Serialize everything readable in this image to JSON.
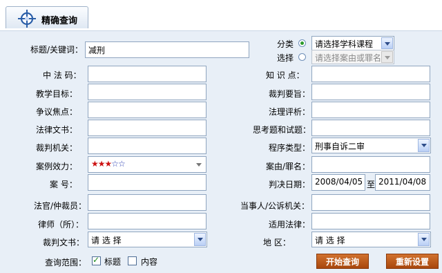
{
  "tab": {
    "label": "精确查询"
  },
  "form": {
    "keyword_label": "标题/关键词：",
    "keyword_value": "减刑",
    "category_label": "分类",
    "category_value": "请选择学科课程",
    "select_label": "选择",
    "select_placeholder": "请选择案由或罪名",
    "left": [
      {
        "label": "中  法  码：",
        "value": ""
      },
      {
        "label": "教学目标：",
        "value": ""
      },
      {
        "label": "争议焦点：",
        "value": ""
      },
      {
        "label": "法律文书：",
        "value": ""
      },
      {
        "label": "裁判机关：",
        "value": ""
      },
      {
        "label": "案例效力：",
        "value": ""
      },
      {
        "label": "案      号：",
        "value": ""
      },
      {
        "label": "法官/仲裁员：",
        "value": ""
      },
      {
        "label": "律师（所）：",
        "value": ""
      },
      {
        "label": "裁判文书：",
        "value": "请 选 择"
      }
    ],
    "right": [
      {
        "label": "知  识  点：",
        "value": ""
      },
      {
        "label": "裁判要旨：",
        "value": ""
      },
      {
        "label": "法理评析：",
        "value": ""
      },
      {
        "label": "思考题和试题：",
        "value": ""
      },
      {
        "label": "程序类型：",
        "value": "刑事自诉二审"
      },
      {
        "label": "案由/罪名：",
        "value": ""
      },
      {
        "label": "判决日期：",
        "value": ""
      },
      {
        "label": "当事人/公诉机关：",
        "value": ""
      },
      {
        "label": "适用法律：",
        "value": ""
      },
      {
        "label": "地      区：",
        "value": "请 选 择"
      }
    ],
    "case_effect": {
      "filled": "★★★",
      "empty": "☆☆",
      "rating": 3,
      "max": 5
    },
    "date_from": "2008/04/05",
    "date_to_prefix": "至",
    "date_to": "2011/04/08",
    "scope_label": "查询范围：",
    "scope_title": "标题",
    "scope_content": "内容"
  },
  "buttons": {
    "search": "开始查询",
    "reset": "重新设置"
  },
  "colors": {
    "accent": "#b85516",
    "background": "#e8eff7",
    "border": "#8fa5bf"
  }
}
